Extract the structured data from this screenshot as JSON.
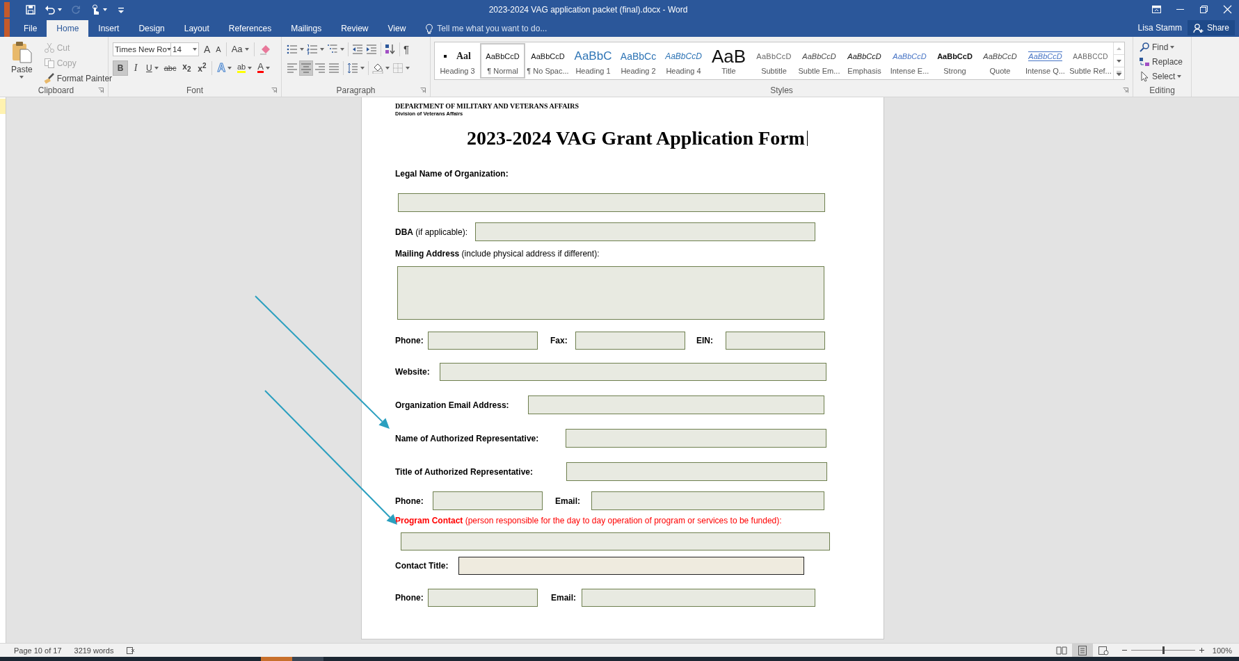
{
  "window": {
    "title": "2023-2024  VAG application packet (final).docx - Word"
  },
  "quick_access": [
    {
      "kind": "save",
      "disabled": false
    },
    {
      "kind": "undo",
      "disabled": false
    },
    {
      "kind": "redo",
      "disabled": true
    },
    {
      "kind": "touch",
      "disabled": false
    },
    {
      "kind": "customize",
      "disabled": false
    }
  ],
  "tabs": [
    {
      "label": "File",
      "selected": false
    },
    {
      "label": "Home",
      "selected": true
    },
    {
      "label": "Insert",
      "selected": false
    },
    {
      "label": "Design",
      "selected": false
    },
    {
      "label": "Layout",
      "selected": false
    },
    {
      "label": "References",
      "selected": false
    },
    {
      "label": "Mailings",
      "selected": false
    },
    {
      "label": "Review",
      "selected": false
    },
    {
      "label": "View",
      "selected": false
    }
  ],
  "tell_me": {
    "placeholder": "Tell me what you want to do..."
  },
  "account": {
    "user": "Lisa Stamm",
    "share": "Share"
  },
  "ribbon": {
    "groups": [
      {
        "kind": "clipboard",
        "label": "Clipboard",
        "paste": "Paste",
        "items": [
          {
            "kind": "cut",
            "label": "Cut",
            "disabled": true
          },
          {
            "kind": "copy",
            "label": "Copy",
            "disabled": true
          },
          {
            "kind": "painter",
            "label": "Format Painter",
            "disabled": false
          }
        ]
      },
      {
        "kind": "font",
        "label": "Font",
        "font_name": "Times New Ro",
        "font_size": "14",
        "tools": [
          {
            "kind": "grow",
            "text": "A"
          },
          {
            "kind": "shrink",
            "text": "A"
          },
          {
            "kind": "case",
            "text": "Aa"
          },
          {
            "kind": "clear"
          }
        ],
        "format": [
          {
            "kind": "bold",
            "text": "B",
            "on": true
          },
          {
            "kind": "italic",
            "text": "I",
            "on": false
          },
          {
            "kind": "underline",
            "text": "U",
            "on": false
          },
          {
            "kind": "strike",
            "text": "abc",
            "on": false
          },
          {
            "kind": "subscript",
            "text": "x$_{2}$",
            "on": false
          },
          {
            "kind": "superscript",
            "text": "x$^{2}$",
            "on": false
          },
          {
            "kind": "effects",
            "text": "A"
          },
          {
            "kind": "highlight",
            "text": "ab"
          },
          {
            "kind": "color",
            "text": "A"
          }
        ]
      },
      {
        "kind": "paragraph",
        "label": "Paragraph",
        "marks": "¶",
        "alignment": [
          {
            "kind": "left",
            "selected": false
          },
          {
            "kind": "center",
            "selected": true
          },
          {
            "kind": "right",
            "selected": false
          },
          {
            "kind": "justify",
            "selected": false
          }
        ]
      },
      {
        "kind": "styles",
        "label": "Styles",
        "items": [
          {
            "kind": "heading3",
            "preview": "Aal",
            "name": "Heading 3",
            "selected": false
          },
          {
            "kind": "normal",
            "preview": "AaBbCcD",
            "name": "¶ Normal",
            "selected": true
          },
          {
            "kind": "normal",
            "preview": "AaBbCcD",
            "name": "¶ No Spac...",
            "selected": false
          },
          {
            "kind": "heading1",
            "preview": "AaBbC",
            "name": "Heading 1",
            "selected": false
          },
          {
            "kind": "heading2",
            "preview": "AaBbCc",
            "name": "Heading 2",
            "selected": false
          },
          {
            "kind": "heading4",
            "preview": "AaBbCcD",
            "name": "Heading 4",
            "selected": false
          },
          {
            "kind": "title",
            "preview": "AaB",
            "name": "Title",
            "selected": false
          },
          {
            "kind": "subtitle",
            "preview": "AaBbCcD",
            "name": "Subtitle",
            "selected": false
          },
          {
            "kind": "subtle",
            "preview": "AaBbCcD",
            "name": "Subtle Em...",
            "selected": false
          },
          {
            "kind": "emphasis",
            "preview": "AaBbCcD",
            "name": "Emphasis",
            "selected": false
          },
          {
            "kind": "intense",
            "preview": "AaBbCcD",
            "name": "Intense E...",
            "selected": false
          },
          {
            "kind": "strong",
            "preview": "AaBbCcD",
            "name": "Strong",
            "selected": false
          },
          {
            "kind": "subtle",
            "preview": "AaBbCcD",
            "name": "Quote",
            "selected": false
          },
          {
            "kind": "intense_quote",
            "preview": "AaBbCcD",
            "name": "Intense Q...",
            "selected": false
          },
          {
            "kind": "reference",
            "preview": "AABBCCD",
            "name": "Subtle Ref...",
            "selected": false
          }
        ]
      },
      {
        "kind": "editing",
        "label": "Editing",
        "items": [
          {
            "kind": "find",
            "label": "Find"
          },
          {
            "kind": "replace",
            "label": "Replace"
          },
          {
            "kind": "select",
            "label": "Select"
          }
        ]
      }
    ]
  },
  "document": {
    "header": "DEPARTMENT OF MILITARY AND VETERANS AFFAIRS",
    "subheader": "Division of Veterans Affairs",
    "title": "2023-2024 VAG Grant Application Form",
    "rows": [
      {
        "cells": [
          {
            "kind": "label",
            "text": "Legal Name of Organization:",
            "bold": true,
            "alert": false
          }
        ]
      },
      {
        "cells": [
          {
            "kind": "field",
            "active": false
          }
        ]
      },
      {
        "cells": [
          {
            "kind": "label",
            "text": "**DBA** (if applicable):",
            "bold": false,
            "alert": false
          },
          {
            "kind": "field",
            "active": false
          }
        ]
      },
      {
        "cells": [
          {
            "kind": "label",
            "text": "**Mailing Address** (include physical address if different):",
            "bold": false,
            "alert": false
          }
        ]
      },
      {
        "cells": [
          {
            "kind": "area",
            "active": false
          }
        ]
      },
      {
        "cells": [
          {
            "kind": "label",
            "text": "Phone:",
            "bold": true,
            "alert": false
          },
          {
            "kind": "field",
            "active": false
          },
          {
            "kind": "label",
            "text": "Fax:",
            "bold": true,
            "alert": false
          },
          {
            "kind": "field",
            "active": false
          },
          {
            "kind": "label",
            "text": "EIN:",
            "bold": true,
            "alert": false
          },
          {
            "kind": "field",
            "active": false
          }
        ]
      },
      {
        "cells": [
          {
            "kind": "label",
            "text": "Website:",
            "bold": true,
            "alert": false
          },
          {
            "kind": "field",
            "active": false
          }
        ]
      },
      {
        "cells": [
          {
            "kind": "label",
            "text": "Organization Email Address:",
            "bold": true,
            "alert": false
          },
          {
            "kind": "field",
            "active": false
          }
        ]
      },
      {
        "cells": [
          {
            "kind": "label",
            "text": "Name of Authorized Representative:",
            "bold": true,
            "alert": false
          },
          {
            "kind": "field",
            "active": false
          }
        ]
      },
      {
        "cells": [
          {
            "kind": "label",
            "text": "Title of Authorized Representative:",
            "bold": true,
            "alert": false
          },
          {
            "kind": "field",
            "active": false
          }
        ]
      },
      {
        "cells": [
          {
            "kind": "label",
            "text": "Phone:",
            "bold": true,
            "alert": false
          },
          {
            "kind": "field",
            "active": false
          },
          {
            "kind": "label",
            "text": "Email:",
            "bold": true,
            "alert": false
          },
          {
            "kind": "field",
            "active": false
          }
        ]
      },
      {
        "cells": [
          {
            "kind": "label",
            "text": "**Program Contact** (person responsible for the day to day operation of program or services to be funded):",
            "bold": false,
            "alert": true
          }
        ]
      },
      {
        "cells": [
          {
            "kind": "field",
            "active": false
          }
        ]
      },
      {
        "cells": [
          {
            "kind": "label",
            "text": "Contact Title:",
            "bold": true,
            "alert": false
          },
          {
            "kind": "field",
            "active": true
          }
        ]
      },
      {
        "cells": [
          {
            "kind": "label",
            "text": "Phone:",
            "bold": true,
            "alert": false
          },
          {
            "kind": "field",
            "active": false
          },
          {
            "kind": "label",
            "text": "Email:",
            "bold": true,
            "alert": false
          },
          {
            "kind": "field",
            "active": false
          }
        ]
      }
    ]
  },
  "annotations": [
    {
      "kind": "arrow"
    },
    {
      "kind": "arrow"
    }
  ],
  "status_bar": {
    "page": "Page 10 of 17",
    "words": "3219 words",
    "views": [
      {
        "kind": "read",
        "selected": false
      },
      {
        "kind": "print",
        "selected": true
      },
      {
        "kind": "web",
        "selected": false
      }
    ],
    "zoom": {
      "level": 0.5,
      "reading": "100%"
    }
  }
}
